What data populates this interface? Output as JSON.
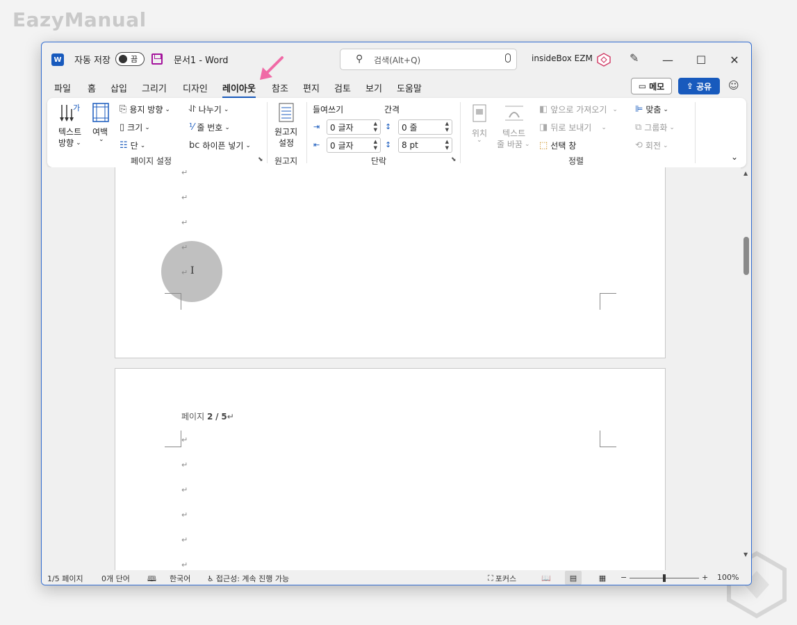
{
  "watermark": {
    "text": "EazyManual"
  },
  "titlebar": {
    "autosave_label": "자동 저장",
    "autosave_state": "끔",
    "doc_title": "문서1  -  Word",
    "search_placeholder": "검색(Alt+Q)",
    "user_name": "insideBox EZM"
  },
  "tabs": [
    "파일",
    "홈",
    "삽입",
    "그리기",
    "디자인",
    "레이아웃",
    "참조",
    "편지",
    "검토",
    "보기",
    "도움말"
  ],
  "active_tab": "레이아웃",
  "actions": {
    "memo": "메모",
    "share": "공유"
  },
  "ribbon": {
    "page_setup": {
      "text_direction": "텍스트",
      "text_direction2": "방향",
      "margins": "여백",
      "orientation": "용지 방향",
      "size": "크기",
      "columns": "단",
      "breaks": "나누기",
      "line_numbers": "줄 번호",
      "hyphenation": "하이픈 넣기",
      "group_label": "페이지 설정"
    },
    "manuscript": {
      "label1": "원고지",
      "label2": "설정",
      "group_label": "원고지"
    },
    "paragraph": {
      "indent_label": "들여쓰기",
      "spacing_label": "간격",
      "indent_left": "0 글자",
      "indent_right": "0 글자",
      "spacing_before": "0 줄",
      "spacing_after": "8 pt",
      "group_label": "단락"
    },
    "arrange": {
      "position": "위치",
      "wrap_text1": "텍스트",
      "wrap_text2": "줄 바꿈",
      "bring_forward": "앞으로 가져오기",
      "send_backward": "뒤로 보내기",
      "selection_pane": "선택 창",
      "align": "맞춤",
      "group": "그룹화",
      "rotate": "회전",
      "group_label": "정렬"
    }
  },
  "document": {
    "page_field_prefix": "페이지",
    "page_field_current": "2",
    "page_field_sep": "/",
    "page_field_total": "5",
    "para_mark": "↵"
  },
  "statusbar": {
    "page": "1/5 페이지",
    "words": "0개 단어",
    "language": "한국어",
    "accessibility": "접근성: 계속 진행 가능",
    "focus": "포커스",
    "zoom": "100%",
    "zoom_minus": "−",
    "zoom_plus": "+"
  }
}
